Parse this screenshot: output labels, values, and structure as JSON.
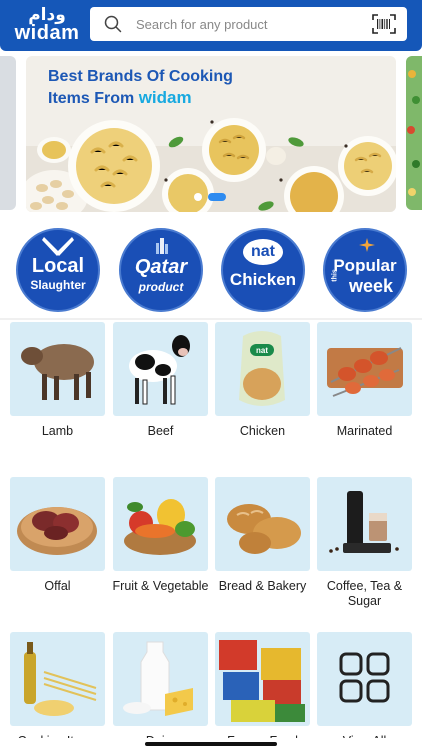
{
  "header": {
    "logo_ar": "ودام",
    "logo_en": "widam",
    "search_placeholder": "Search for any product"
  },
  "banner": {
    "title_line1": "Best Brands Of Cooking",
    "title_line2_prefix": "Items From ",
    "title_line2_brand": "widam",
    "slide_index": 2,
    "slide_count": 2
  },
  "brands": [
    {
      "line1": "Local",
      "line2": "Slaughter"
    },
    {
      "line1": "Qatar",
      "line2": "product"
    },
    {
      "line1": "nat",
      "line2": "Chicken"
    },
    {
      "line1": "Popular",
      "line2": "week",
      "side": "this"
    }
  ],
  "categories": [
    {
      "label": "Lamb",
      "icon": "lamb-image"
    },
    {
      "label": "Beef",
      "icon": "cow-image"
    },
    {
      "label": "Chicken",
      "icon": "chicken-pack-image"
    },
    {
      "label": "Marinated",
      "icon": "kebab-image"
    },
    {
      "label": "Offal",
      "icon": "offal-image"
    },
    {
      "label": "Fruit & Vegetable",
      "icon": "fruit-basket-image"
    },
    {
      "label": "Bread & Bakery",
      "icon": "bread-image"
    },
    {
      "label": "Coffee, Tea & Sugar",
      "icon": "coffee-image"
    },
    {
      "label": "Cooking Items",
      "icon": "oil-pasta-image"
    },
    {
      "label": "Dairy",
      "icon": "milk-cheese-image"
    },
    {
      "label": "Frozen Food",
      "icon": "frozen-boxes-image"
    },
    {
      "label": "View All",
      "icon": "grid-icon"
    }
  ],
  "colors": {
    "header": "#1557b8",
    "tile": "#d7ecf6",
    "brand_circle": "#1a4fb6",
    "active_dot": "#2e8bf0"
  }
}
